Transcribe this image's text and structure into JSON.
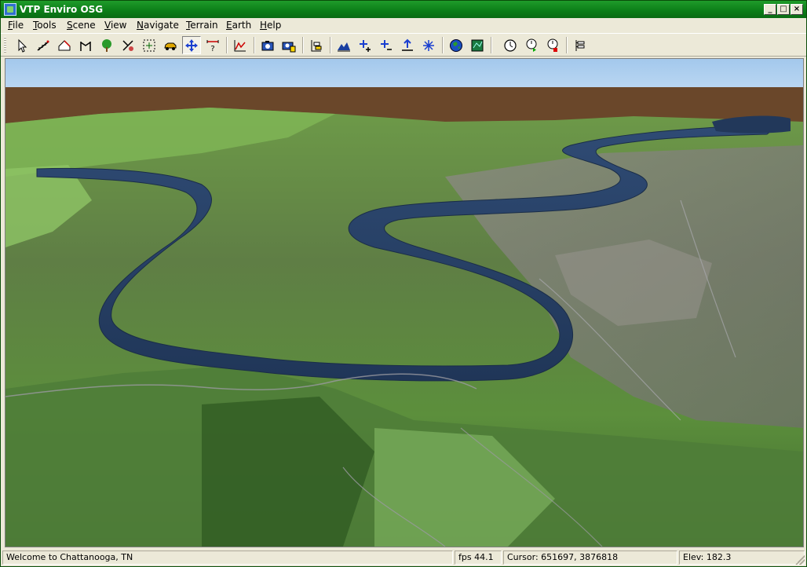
{
  "window": {
    "title": "VTP Enviro OSG",
    "controls": {
      "minimize": "_",
      "maximize": "□",
      "close": "×"
    }
  },
  "menu": [
    {
      "label": "File",
      "accel": "F",
      "rest": "ile"
    },
    {
      "label": "Tools",
      "accel": "T",
      "rest": "ools"
    },
    {
      "label": "Scene",
      "accel": "S",
      "rest": "cene"
    },
    {
      "label": "View",
      "accel": "V",
      "rest": "iew"
    },
    {
      "label": "Navigate",
      "accel": "N",
      "rest": "avigate"
    },
    {
      "label": "Terrain",
      "accel": "T",
      "rest": "errain"
    },
    {
      "label": "Earth",
      "accel": "E",
      "rest": "arth"
    },
    {
      "label": "Help",
      "accel": "H",
      "rest": "elp"
    }
  ],
  "toolbar": {
    "icons": [
      "select-arrow-icon",
      "fence-tool-icon",
      "building-tool-icon",
      "route-tool-icon",
      "plant-tree-icon",
      "instance-tool-icon",
      "move-selection-icon",
      "vehicle-icon",
      "navigate-move-icon",
      "measure-distance-icon",
      "elevation-profile-icon",
      "camera-icon",
      "camera-save-icon",
      "layers-icon",
      "terrain-relief-icon",
      "zoom-in-icon",
      "zoom-out-icon",
      "elevation-up-icon",
      "spread-icon",
      "globe-icon",
      "map-icon",
      "clock-icon",
      "clock-play-icon",
      "clock-stop-icon",
      "scene-graph-icon"
    ],
    "active": "navigate-move-icon"
  },
  "scene": {
    "sky_color": "#a8cbed",
    "ground_color": "#6a472a",
    "river_color": "#233d63",
    "terrain_color": "#5d8a3e"
  },
  "status": {
    "message": "Welcome to Chattanooga, TN",
    "fps": "fps 44.1",
    "cursor": "Cursor: 651697, 3876818",
    "elev": "Elev: 182.3"
  }
}
